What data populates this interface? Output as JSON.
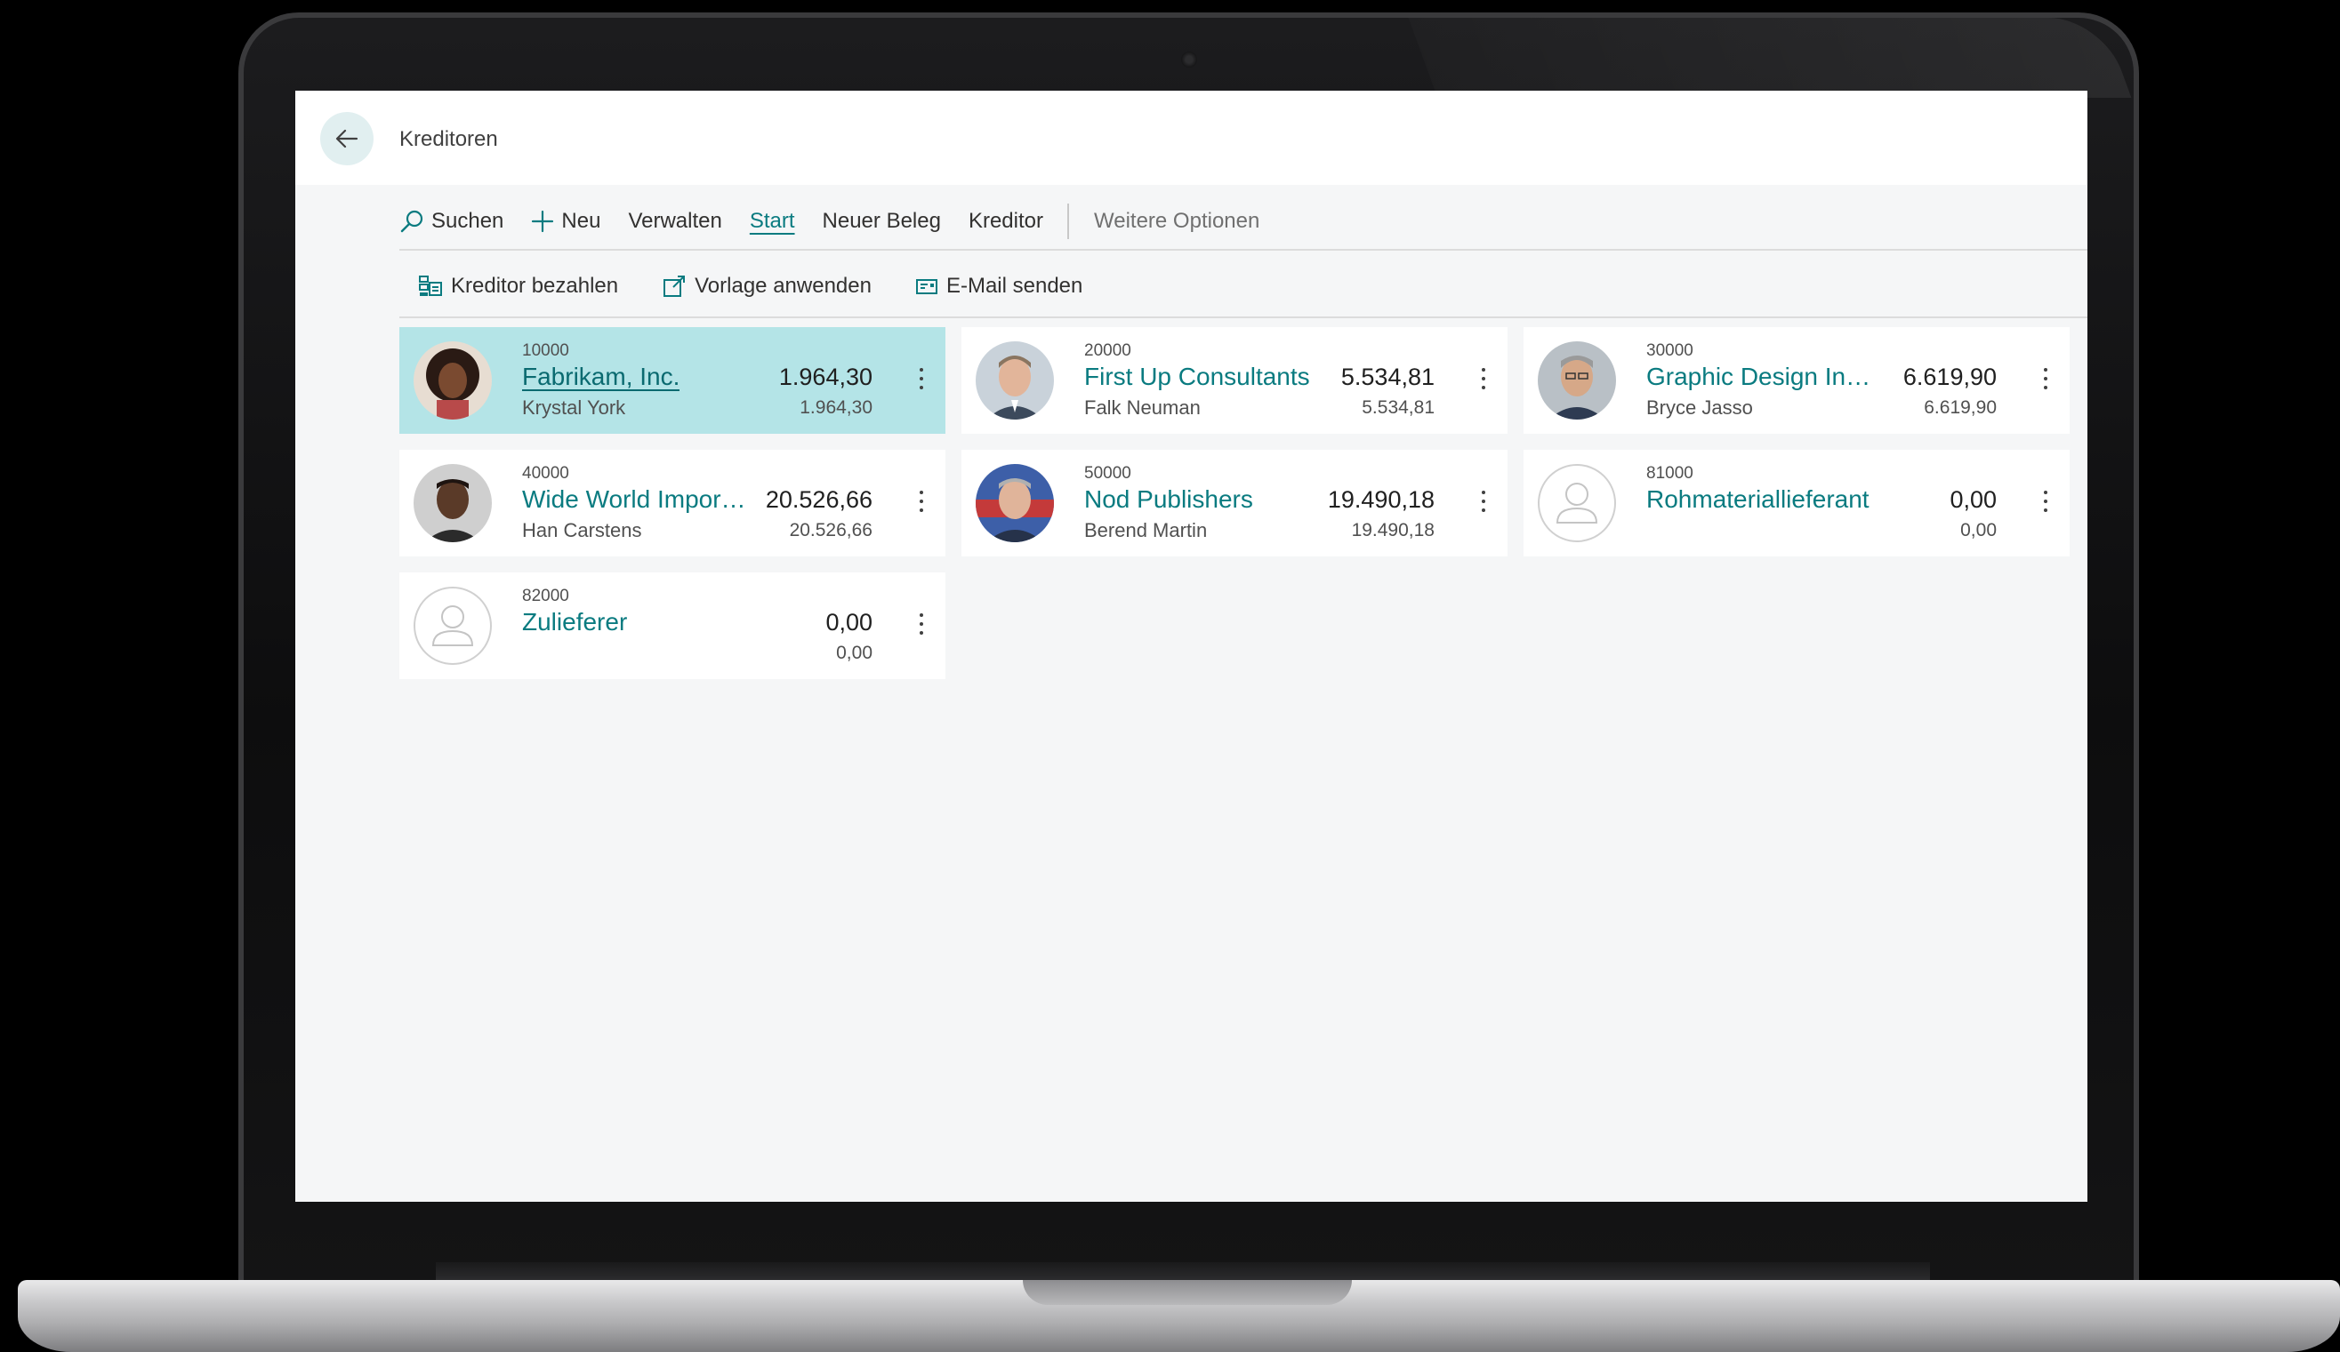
{
  "page": {
    "title": "Kreditoren"
  },
  "menu": {
    "items": [
      {
        "label": "Suchen",
        "icon": "search-icon"
      },
      {
        "label": "Neu",
        "icon": "plus-icon"
      },
      {
        "label": "Verwalten"
      },
      {
        "label": "Start",
        "active": true
      },
      {
        "label": "Neuer Beleg"
      },
      {
        "label": "Kreditor"
      }
    ],
    "more": "Weitere Optionen"
  },
  "actions": [
    {
      "label": "Kreditor bezahlen",
      "icon": "pay-vendor-icon"
    },
    {
      "label": "Vorlage anwenden",
      "icon": "apply-template-icon"
    },
    {
      "label": "E-Mail senden",
      "icon": "email-icon"
    }
  ],
  "vendors": [
    {
      "no": "10000",
      "name": "Fabrikam, Inc.",
      "contact": "Krystal York",
      "balance": "1.964,30",
      "balance_due": "1.964,30",
      "selected": true,
      "avatar": "photo"
    },
    {
      "no": "20000",
      "name": "First Up Consultants",
      "contact": "Falk Neuman",
      "balance": "5.534,81",
      "balance_due": "5.534,81",
      "avatar": "photo"
    },
    {
      "no": "30000",
      "name": "Graphic Design Institute",
      "contact": "Bryce Jasso",
      "balance": "6.619,90",
      "balance_due": "6.619,90",
      "avatar": "photo"
    },
    {
      "no": "40000",
      "name": "Wide World Importers",
      "contact": "Han Carstens",
      "balance": "20.526,66",
      "balance_due": "20.526,66",
      "avatar": "photo"
    },
    {
      "no": "50000",
      "name": "Nod Publishers",
      "contact": "Berend Martin",
      "balance": "19.490,18",
      "balance_due": "19.490,18",
      "avatar": "photo"
    },
    {
      "no": "81000",
      "name": "Rohmateriallieferant",
      "contact": "",
      "balance": "0,00",
      "balance_due": "0,00",
      "avatar": "placeholder"
    },
    {
      "no": "82000",
      "name": "Zulieferer",
      "contact": "",
      "balance": "0,00",
      "balance_due": "0,00",
      "avatar": "placeholder"
    }
  ],
  "colors": {
    "accent": "#0a7b80",
    "selected_tile": "#b4e4e7",
    "back_button_bg": "#e1eff0"
  }
}
